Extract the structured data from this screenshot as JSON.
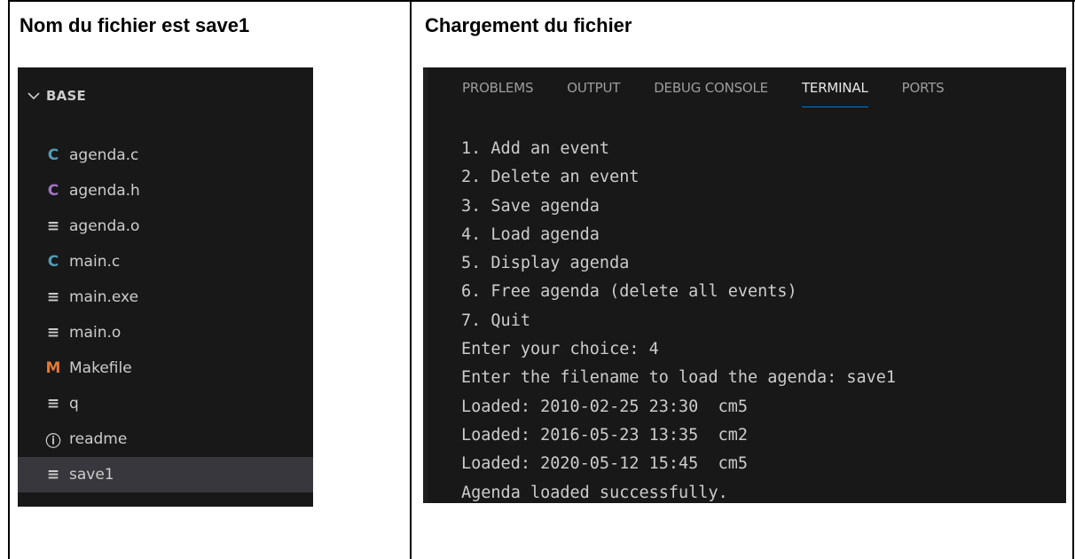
{
  "headings": {
    "left": "Nom du fichier est save1",
    "right": "Chargement du fichier"
  },
  "explorer": {
    "folder": "BASE",
    "files": [
      {
        "name": "agenda.c",
        "icon": "c-file-icon",
        "glyph": "C",
        "kind": "c"
      },
      {
        "name": "agenda.h",
        "icon": "c-header-icon",
        "glyph": "C",
        "kind": "h"
      },
      {
        "name": "agenda.o",
        "icon": "text-file-icon",
        "glyph": "≡",
        "kind": "text"
      },
      {
        "name": "main.c",
        "icon": "c-file-icon",
        "glyph": "C",
        "kind": "c"
      },
      {
        "name": "main.exe",
        "icon": "text-file-icon",
        "glyph": "≡",
        "kind": "text"
      },
      {
        "name": "main.o",
        "icon": "text-file-icon",
        "glyph": "≡",
        "kind": "text"
      },
      {
        "name": "Makefile",
        "icon": "makefile-icon",
        "glyph": "M",
        "kind": "m"
      },
      {
        "name": "q",
        "icon": "text-file-icon",
        "glyph": "≡",
        "kind": "text"
      },
      {
        "name": "readme",
        "icon": "info-icon",
        "glyph": "ⓘ",
        "kind": "info"
      },
      {
        "name": "save1",
        "icon": "text-file-icon",
        "glyph": "≡",
        "kind": "text",
        "selected": true
      }
    ]
  },
  "terminal": {
    "tabs": [
      {
        "label": "PROBLEMS",
        "active": false
      },
      {
        "label": "OUTPUT",
        "active": false
      },
      {
        "label": "DEBUG CONSOLE",
        "active": false
      },
      {
        "label": "TERMINAL",
        "active": true
      },
      {
        "label": "PORTS",
        "active": false
      }
    ],
    "lines": [
      "1. Add an event",
      "2. Delete an event",
      "3. Save agenda",
      "4. Load agenda",
      "5. Display agenda",
      "6. Free agenda (delete all events)",
      "7. Quit",
      "Enter your choice: 4",
      "Enter the filename to load the agenda: save1",
      "Loaded: 2010-02-25 23:30  cm5",
      "Loaded: 2016-05-23 13:35  cm2",
      "Loaded: 2020-05-12 15:45  cm5",
      "Agenda loaded successfully."
    ]
  },
  "colors": {
    "panel_bg": "#181818",
    "selected_row": "#37373d",
    "c_icon": "#519aba",
    "h_icon": "#a074c4",
    "makefile_icon": "#e37933",
    "active_tab_underline": "#0078d4"
  }
}
